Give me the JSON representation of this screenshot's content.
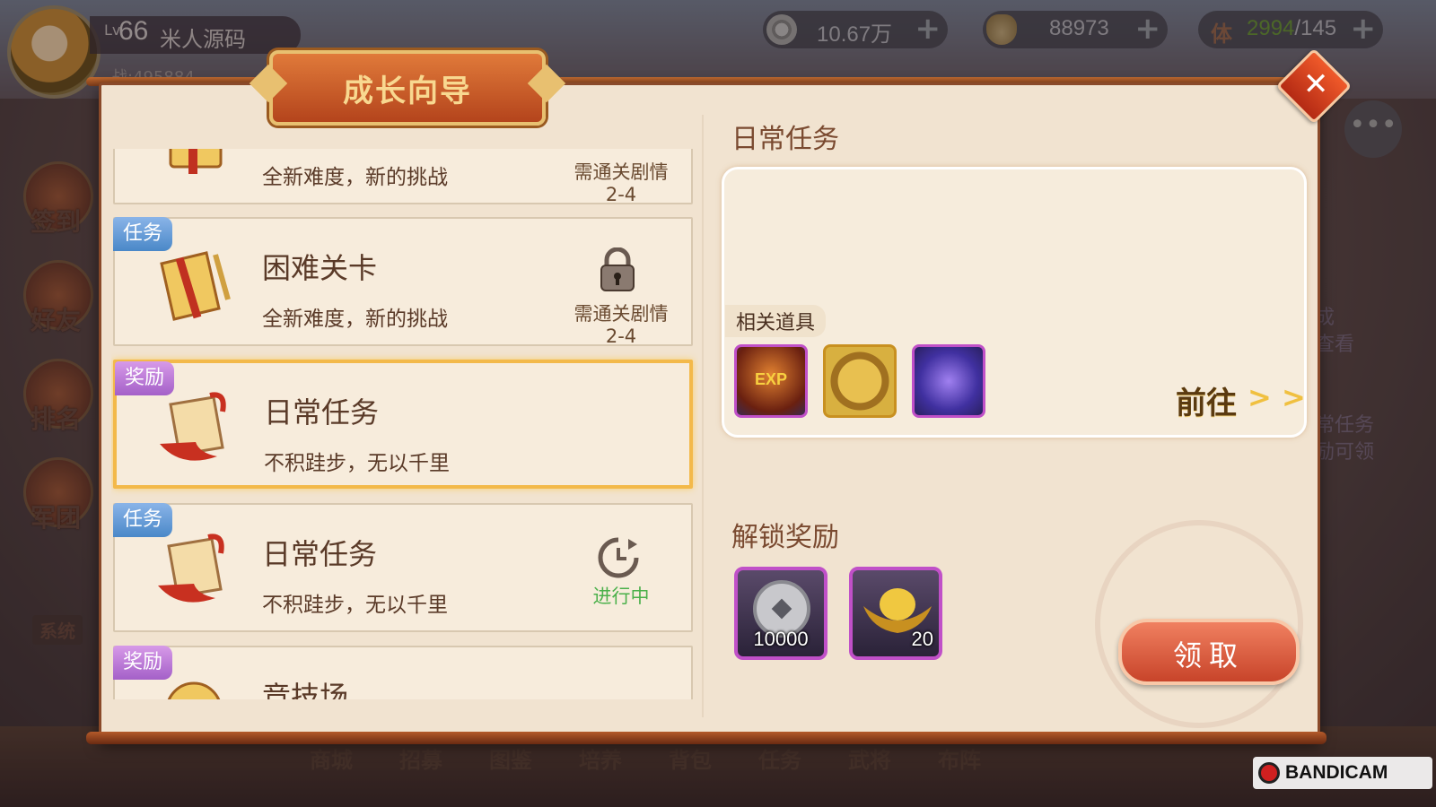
{
  "player": {
    "lv_prefix": "Lv",
    "level": "66",
    "name": "米人源码",
    "power": "战:495884"
  },
  "resources": [
    {
      "icon": "coin-icon",
      "value": "10.67万"
    },
    {
      "icon": "gold-ingot-icon",
      "value": "88973"
    },
    {
      "icon": "stamina-icon",
      "label": "体",
      "current": "2994",
      "max": "/145"
    }
  ],
  "side_menu": [
    "签到",
    "好友",
    "排名",
    "军团"
  ],
  "system_label": "系统",
  "bottom_nav": [
    "商城",
    "招募",
    "图鉴",
    "培养",
    "背包",
    "任务",
    "武将",
    "布阵"
  ],
  "right_deco": {
    "line1": "成",
    "line2": "查看",
    "line3": "常任务",
    "line4": "励可领"
  },
  "modal": {
    "title": "成长向导",
    "close": "✕"
  },
  "list": [
    {
      "tag": "",
      "title": "",
      "subtitle": "全新难度，新的挑战",
      "condition": "需通关剧情\n2-4"
    },
    {
      "tag": "任务",
      "title": "困难关卡",
      "subtitle": "全新难度，新的挑战",
      "condition": "需通关剧情\n2-4"
    },
    {
      "tag": "奖励",
      "title": "日常任务",
      "subtitle": "不积跬步，无以千里",
      "condition": ""
    },
    {
      "tag": "任务",
      "title": "日常任务",
      "subtitle": "不积跬步，无以千里",
      "status": "进行中"
    },
    {
      "tag": "奖励",
      "title": "竞技场",
      "subtitle": ""
    }
  ],
  "detail": {
    "title": "日常任务",
    "items_label": "相关道具",
    "items": [
      {
        "icon": "exp-orb-icon",
        "text": "EXP"
      },
      {
        "icon": "gold-token-icon"
      },
      {
        "icon": "purple-spirit-icon"
      }
    ],
    "goto_label": "前往",
    "goto_arrows": "> >",
    "unlock_title": "解锁奖励",
    "rewards": [
      {
        "icon": "silver-coin-icon",
        "qty": "10000"
      },
      {
        "icon": "gold-ingot-icon",
        "qty": "20"
      }
    ],
    "claim_label": "领取"
  },
  "watermark": "BANDICAM",
  "colors": {
    "task_tag": "#4a88c8",
    "reward_tag": "#a460c8",
    "selected_border": "#f3b94a",
    "in_progress": "#4ab04a"
  }
}
